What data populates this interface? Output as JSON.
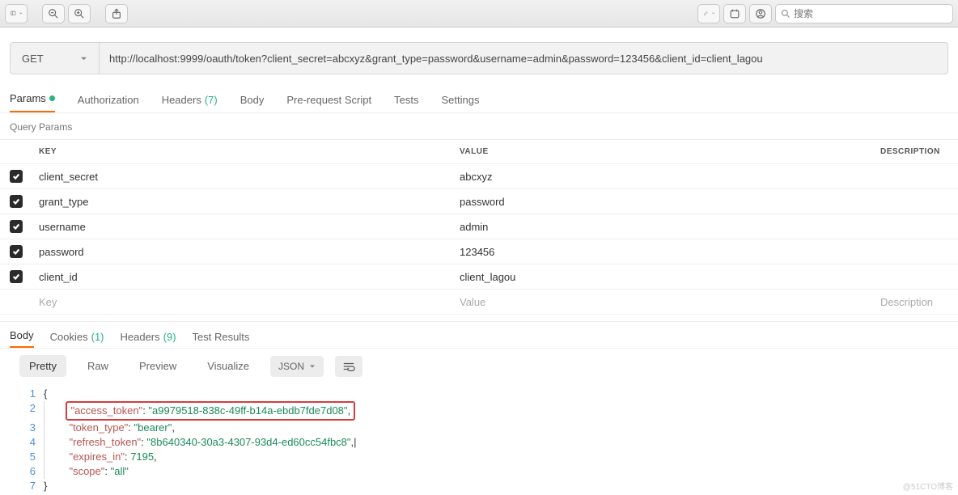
{
  "toolbar": {
    "search_placeholder": "搜索"
  },
  "request": {
    "method": "GET",
    "url": "http://localhost:9999/oauth/token?client_secret=abcxyz&grant_type=password&username=admin&password=123456&client_id=client_lagou"
  },
  "tabs": {
    "params": "Params",
    "authorization": "Authorization",
    "headers": "Headers",
    "headers_count": "(7)",
    "body": "Body",
    "prerequest": "Pre-request Script",
    "tests": "Tests",
    "settings": "Settings"
  },
  "query": {
    "title": "Query Params",
    "head_key": "KEY",
    "head_value": "VALUE",
    "head_desc": "DESCRIPTION",
    "rows": [
      {
        "key": "client_secret",
        "value": "abcxyz"
      },
      {
        "key": "grant_type",
        "value": "password"
      },
      {
        "key": "username",
        "value": "admin"
      },
      {
        "key": "password",
        "value": "123456"
      },
      {
        "key": "client_id",
        "value": "client_lagou"
      }
    ],
    "key_placeholder": "Key",
    "value_placeholder": "Value",
    "desc_placeholder": "Description"
  },
  "response_tabs": {
    "body": "Body",
    "cookies": "Cookies",
    "cookies_count": "(1)",
    "headers": "Headers",
    "headers_count": "(9)",
    "tests": "Test Results"
  },
  "formatbar": {
    "pretty": "Pretty",
    "raw": "Raw",
    "preview": "Preview",
    "visualize": "Visualize",
    "language": "JSON"
  },
  "json_response": {
    "access_token": "a9979518-838c-49ff-b14a-ebdb7fde7d08",
    "token_type": "bearer",
    "refresh_token": "8b640340-30a3-4307-93d4-ed60cc54fbc8",
    "expires_in": 7195,
    "scope": "all"
  },
  "watermark": "@51CTO博客"
}
